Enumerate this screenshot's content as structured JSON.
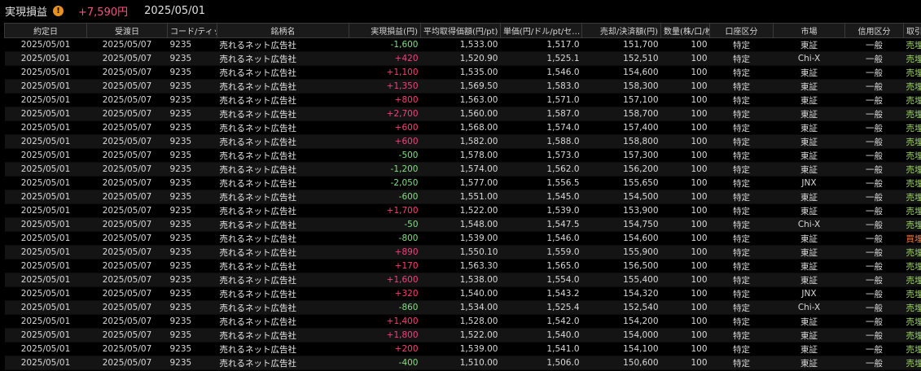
{
  "header": {
    "title": "実現損益",
    "total": "+7,590円",
    "date": "2025/05/01"
  },
  "columns": [
    "約定日",
    "受渡日",
    "コード/ティッ…",
    "銘柄名",
    "実現損益(円)",
    "平均取得価額(円/pt)",
    "単価(円/ドル/pt/セ…",
    "売却/決済額(円)",
    "数量(株/口/枚)",
    "口座区分",
    "市場",
    "信用区分",
    "取引"
  ],
  "rows": [
    {
      "trade_date": "2025/05/01",
      "settle_date": "2025/05/07",
      "code": "9235",
      "name": "売れるネット広告社",
      "pnl": "-1,600",
      "avg_price": "1,533.00",
      "unit_price": "1,517.0",
      "amount": "151,700",
      "qty": "100",
      "account": "特定",
      "market": "東証",
      "credit": "一般",
      "trade": "売埋"
    },
    {
      "trade_date": "2025/05/01",
      "settle_date": "2025/05/07",
      "code": "9235",
      "name": "売れるネット広告社",
      "pnl": "+420",
      "avg_price": "1,520.90",
      "unit_price": "1,525.1",
      "amount": "152,510",
      "qty": "100",
      "account": "特定",
      "market": "Chi-X",
      "credit": "一般",
      "trade": "売埋"
    },
    {
      "trade_date": "2025/05/01",
      "settle_date": "2025/05/07",
      "code": "9235",
      "name": "売れるネット広告社",
      "pnl": "+1,100",
      "avg_price": "1,535.00",
      "unit_price": "1,546.0",
      "amount": "154,600",
      "qty": "100",
      "account": "特定",
      "market": "東証",
      "credit": "一般",
      "trade": "売埋"
    },
    {
      "trade_date": "2025/05/01",
      "settle_date": "2025/05/07",
      "code": "9235",
      "name": "売れるネット広告社",
      "pnl": "+1,350",
      "avg_price": "1,569.50",
      "unit_price": "1,583.0",
      "amount": "158,300",
      "qty": "100",
      "account": "特定",
      "market": "東証",
      "credit": "一般",
      "trade": "売埋"
    },
    {
      "trade_date": "2025/05/01",
      "settle_date": "2025/05/07",
      "code": "9235",
      "name": "売れるネット広告社",
      "pnl": "+800",
      "avg_price": "1,563.00",
      "unit_price": "1,571.0",
      "amount": "157,100",
      "qty": "100",
      "account": "特定",
      "market": "東証",
      "credit": "一般",
      "trade": "売埋"
    },
    {
      "trade_date": "2025/05/01",
      "settle_date": "2025/05/07",
      "code": "9235",
      "name": "売れるネット広告社",
      "pnl": "+2,700",
      "avg_price": "1,560.00",
      "unit_price": "1,587.0",
      "amount": "158,700",
      "qty": "100",
      "account": "特定",
      "market": "東証",
      "credit": "一般",
      "trade": "売埋"
    },
    {
      "trade_date": "2025/05/01",
      "settle_date": "2025/05/07",
      "code": "9235",
      "name": "売れるネット広告社",
      "pnl": "+600",
      "avg_price": "1,568.00",
      "unit_price": "1,574.0",
      "amount": "157,400",
      "qty": "100",
      "account": "特定",
      "market": "東証",
      "credit": "一般",
      "trade": "売埋"
    },
    {
      "trade_date": "2025/05/01",
      "settle_date": "2025/05/07",
      "code": "9235",
      "name": "売れるネット広告社",
      "pnl": "+600",
      "avg_price": "1,582.00",
      "unit_price": "1,588.0",
      "amount": "158,800",
      "qty": "100",
      "account": "特定",
      "market": "東証",
      "credit": "一般",
      "trade": "売埋"
    },
    {
      "trade_date": "2025/05/01",
      "settle_date": "2025/05/07",
      "code": "9235",
      "name": "売れるネット広告社",
      "pnl": "-500",
      "avg_price": "1,578.00",
      "unit_price": "1,573.0",
      "amount": "157,300",
      "qty": "100",
      "account": "特定",
      "market": "東証",
      "credit": "一般",
      "trade": "売埋"
    },
    {
      "trade_date": "2025/05/01",
      "settle_date": "2025/05/07",
      "code": "9235",
      "name": "売れるネット広告社",
      "pnl": "-1,200",
      "avg_price": "1,574.00",
      "unit_price": "1,562.0",
      "amount": "156,200",
      "qty": "100",
      "account": "特定",
      "market": "東証",
      "credit": "一般",
      "trade": "売埋"
    },
    {
      "trade_date": "2025/05/01",
      "settle_date": "2025/05/07",
      "code": "9235",
      "name": "売れるネット広告社",
      "pnl": "-2,050",
      "avg_price": "1,577.00",
      "unit_price": "1,556.5",
      "amount": "155,650",
      "qty": "100",
      "account": "特定",
      "market": "JNX",
      "credit": "一般",
      "trade": "売埋"
    },
    {
      "trade_date": "2025/05/01",
      "settle_date": "2025/05/07",
      "code": "9235",
      "name": "売れるネット広告社",
      "pnl": "-600",
      "avg_price": "1,551.00",
      "unit_price": "1,545.0",
      "amount": "154,500",
      "qty": "100",
      "account": "特定",
      "market": "東証",
      "credit": "一般",
      "trade": "売埋"
    },
    {
      "trade_date": "2025/05/01",
      "settle_date": "2025/05/07",
      "code": "9235",
      "name": "売れるネット広告社",
      "pnl": "+1,700",
      "avg_price": "1,522.00",
      "unit_price": "1,539.0",
      "amount": "153,900",
      "qty": "100",
      "account": "特定",
      "market": "東証",
      "credit": "一般",
      "trade": "売埋"
    },
    {
      "trade_date": "2025/05/01",
      "settle_date": "2025/05/07",
      "code": "9235",
      "name": "売れるネット広告社",
      "pnl": "-50",
      "avg_price": "1,548.00",
      "unit_price": "1,547.5",
      "amount": "154,750",
      "qty": "100",
      "account": "特定",
      "market": "Chi-X",
      "credit": "一般",
      "trade": "売埋"
    },
    {
      "trade_date": "2025/05/01",
      "settle_date": "2025/05/07",
      "code": "9235",
      "name": "売れるネット広告社",
      "pnl": "-800",
      "avg_price": "1,539.00",
      "unit_price": "1,546.0",
      "amount": "154,600",
      "qty": "100",
      "account": "特定",
      "market": "東証",
      "credit": "一般",
      "trade": "買埋"
    },
    {
      "trade_date": "2025/05/01",
      "settle_date": "2025/05/07",
      "code": "9235",
      "name": "売れるネット広告社",
      "pnl": "+890",
      "avg_price": "1,550.10",
      "unit_price": "1,559.0",
      "amount": "155,900",
      "qty": "100",
      "account": "特定",
      "market": "東証",
      "credit": "一般",
      "trade": "売埋"
    },
    {
      "trade_date": "2025/05/01",
      "settle_date": "2025/05/07",
      "code": "9235",
      "name": "売れるネット広告社",
      "pnl": "+170",
      "avg_price": "1,563.30",
      "unit_price": "1,565.0",
      "amount": "156,500",
      "qty": "100",
      "account": "特定",
      "market": "東証",
      "credit": "一般",
      "trade": "売埋"
    },
    {
      "trade_date": "2025/05/01",
      "settle_date": "2025/05/07",
      "code": "9235",
      "name": "売れるネット広告社",
      "pnl": "+1,600",
      "avg_price": "1,538.00",
      "unit_price": "1,554.0",
      "amount": "155,400",
      "qty": "100",
      "account": "特定",
      "market": "東証",
      "credit": "一般",
      "trade": "売埋"
    },
    {
      "trade_date": "2025/05/01",
      "settle_date": "2025/05/07",
      "code": "9235",
      "name": "売れるネット広告社",
      "pnl": "+320",
      "avg_price": "1,540.00",
      "unit_price": "1,543.2",
      "amount": "154,320",
      "qty": "100",
      "account": "特定",
      "market": "JNX",
      "credit": "一般",
      "trade": "売埋"
    },
    {
      "trade_date": "2025/05/01",
      "settle_date": "2025/05/07",
      "code": "9235",
      "name": "売れるネット広告社",
      "pnl": "-860",
      "avg_price": "1,534.00",
      "unit_price": "1,525.4",
      "amount": "152,540",
      "qty": "100",
      "account": "特定",
      "market": "Chi-X",
      "credit": "一般",
      "trade": "売埋"
    },
    {
      "trade_date": "2025/05/01",
      "settle_date": "2025/05/07",
      "code": "9235",
      "name": "売れるネット広告社",
      "pnl": "+1,400",
      "avg_price": "1,528.00",
      "unit_price": "1,542.0",
      "amount": "154,200",
      "qty": "100",
      "account": "特定",
      "market": "東証",
      "credit": "一般",
      "trade": "売埋"
    },
    {
      "trade_date": "2025/05/01",
      "settle_date": "2025/05/07",
      "code": "9235",
      "name": "売れるネット広告社",
      "pnl": "+1,800",
      "avg_price": "1,522.00",
      "unit_price": "1,540.0",
      "amount": "154,000",
      "qty": "100",
      "account": "特定",
      "market": "東証",
      "credit": "一般",
      "trade": "売埋"
    },
    {
      "trade_date": "2025/05/01",
      "settle_date": "2025/05/07",
      "code": "9235",
      "name": "売れるネット広告社",
      "pnl": "+200",
      "avg_price": "1,539.00",
      "unit_price": "1,541.0",
      "amount": "154,100",
      "qty": "100",
      "account": "特定",
      "market": "東証",
      "credit": "一般",
      "trade": "売埋"
    },
    {
      "trade_date": "2025/05/01",
      "settle_date": "2025/05/07",
      "code": "9235",
      "name": "売れるネット広告社",
      "pnl": "-400",
      "avg_price": "1,510.00",
      "unit_price": "1,506.0",
      "amount": "150,600",
      "qty": "100",
      "account": "特定",
      "market": "東証",
      "credit": "一般",
      "trade": "売埋"
    }
  ],
  "colors": {
    "profit": "#ff3c7d",
    "loss": "#7fe07f",
    "sell": "#9bd85a",
    "buy": "#ff7b3a",
    "warning": "#e6921e"
  },
  "icons": {
    "warning": "warning-icon"
  }
}
